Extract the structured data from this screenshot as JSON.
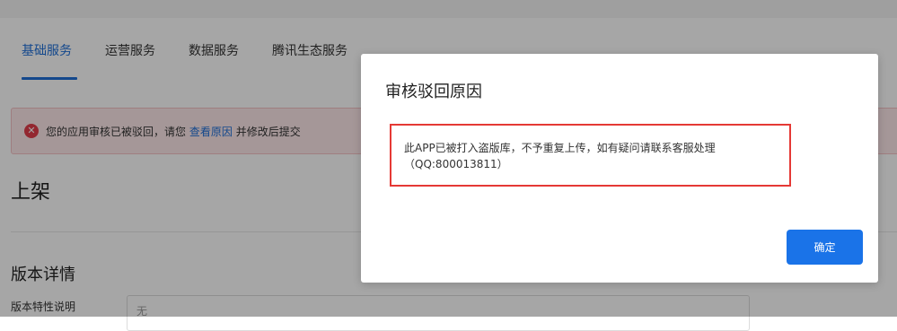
{
  "tabs": [
    {
      "label": "基础服务"
    },
    {
      "label": "运营服务"
    },
    {
      "label": "数据服务"
    },
    {
      "label": "腾讯生态服务"
    }
  ],
  "alert": {
    "prefix": "您的应用审核已被驳回，请您",
    "link": "查看原因",
    "suffix": "并修改后提交"
  },
  "section": {
    "title": "上架",
    "version_title": "版本详情",
    "feature_label": "版本特性说明",
    "feature_value": "无"
  },
  "modal": {
    "title": "审核驳回原因",
    "reason_line1": "此APP已被打入盗版库，不予重复上传，如有疑问请联系客服处理",
    "reason_line2": "（QQ:800013811）",
    "confirm_label": "确定"
  },
  "colors": {
    "accent": "#1f6fd8",
    "alert_bg": "#fde9ea",
    "error": "#e23d4a",
    "highlight_border": "#e53935",
    "button": "#1a73e8"
  }
}
